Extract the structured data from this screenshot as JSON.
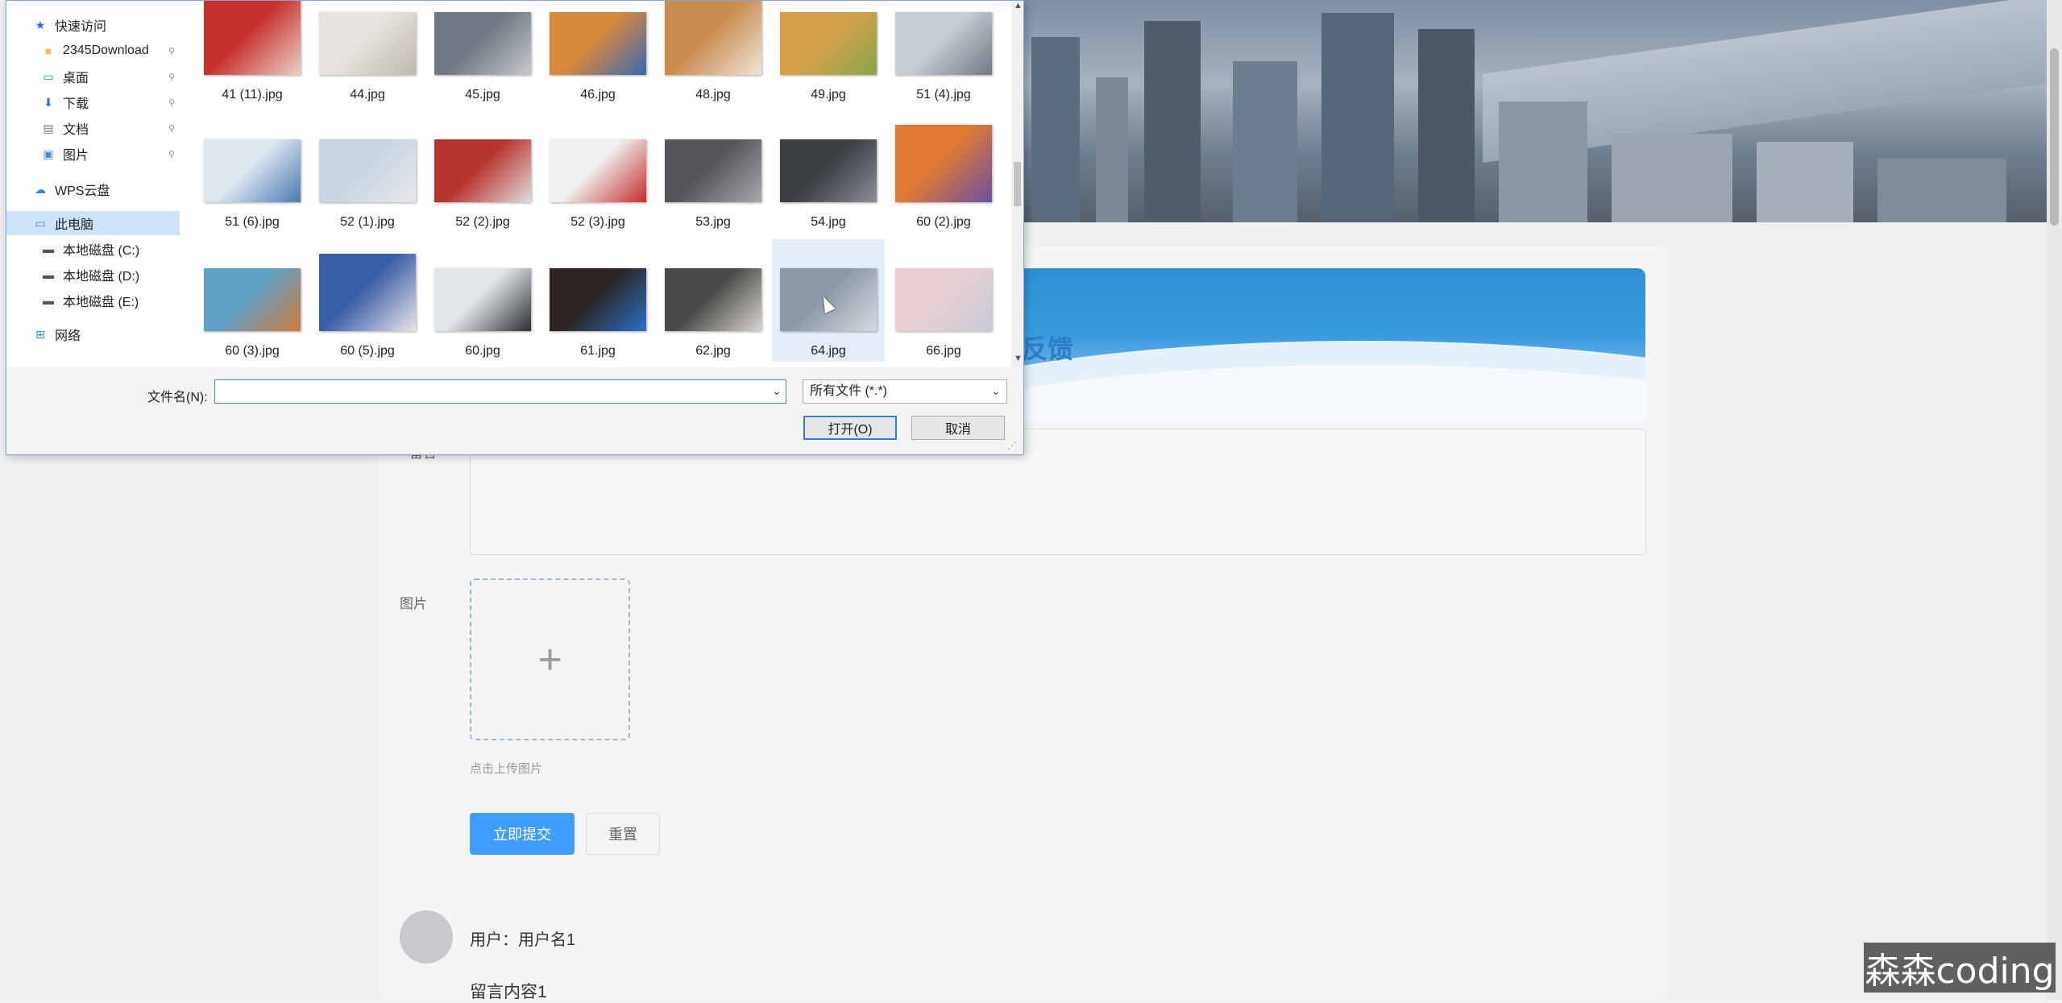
{
  "dialog": {
    "nav": [
      {
        "label": "快速访问",
        "icon": "star-pin-icon",
        "pinned": false
      },
      {
        "label": "2345Download",
        "icon": "folder-icon",
        "pinned": true
      },
      {
        "label": "桌面",
        "icon": "desktop-icon",
        "pinned": true
      },
      {
        "label": "下载",
        "icon": "download-arrow-icon",
        "pinned": true
      },
      {
        "label": "文档",
        "icon": "document-icon",
        "pinned": true
      },
      {
        "label": "图片",
        "icon": "pictures-icon",
        "pinned": true
      },
      {
        "label": "WPS云盘",
        "icon": "cloud-icon",
        "pinned": false
      },
      {
        "label": "此电脑",
        "icon": "computer-icon",
        "pinned": false
      },
      {
        "label": "本地磁盘 (C:)",
        "icon": "drive-icon",
        "pinned": false
      },
      {
        "label": "本地磁盘 (D:)",
        "icon": "drive-icon",
        "pinned": false
      },
      {
        "label": "本地磁盘 (E:)",
        "icon": "drive-icon",
        "pinned": false
      },
      {
        "label": "网络",
        "icon": "network-icon",
        "pinned": false
      }
    ],
    "files": [
      "41 (11).jpg",
      "44.jpg",
      "45.jpg",
      "46.jpg",
      "48.jpg",
      "49.jpg",
      "51 (4).jpg",
      "51 (6).jpg",
      "52 (1).jpg",
      "52 (2).jpg",
      "52 (3).jpg",
      "53.jpg",
      "54.jpg",
      "60 (2).jpg",
      "60 (3).jpg",
      "60 (5).jpg",
      "60.jpg",
      "61.jpg",
      "62.jpg",
      "64.jpg",
      "66.jpg"
    ],
    "thumb_colors": [
      [
        "#c8302e",
        "#e9d2c8"
      ],
      [
        "#e6e3de",
        "#bdb7ae"
      ],
      [
        "#6f7883",
        "#c7c9cc"
      ],
      [
        "#d88a3a",
        "#3868b4"
      ],
      [
        "#c98b4e",
        "#efe4d6"
      ],
      [
        "#d5a24b",
        "#88a54a"
      ],
      [
        "#c8ced6",
        "#707884"
      ],
      [
        "#dfe7f1",
        "#4c78b0"
      ],
      [
        "#c8d5e2",
        "#e7e9ea"
      ],
      [
        "#b8342f",
        "#dedede"
      ],
      [
        "#f0f0f0",
        "#c22b2b"
      ],
      [
        "#55565a",
        "#a7a9ad"
      ],
      [
        "#3a3d42",
        "#8a8f96"
      ],
      [
        "#e07a34",
        "#6b4fa0"
      ],
      [
        "#5e9fc4",
        "#d17d3c"
      ],
      [
        "#3a5ea8",
        "#e8e4e6"
      ],
      [
        "#e4e7ea",
        "#2a2d33"
      ],
      [
        "#2b2420",
        "#2c6fc7"
      ],
      [
        "#4c4a48",
        "#d8d5cf"
      ],
      [
        "#8c9aa8",
        "#d6dadf"
      ],
      [
        "#e8cfd4",
        "#c7cbd5"
      ]
    ],
    "selected_file": "64.jpg",
    "filename_label": "文件名(N):",
    "filename_value": "",
    "filetype_value": "所有文件 (*.*)",
    "open_label": "打开(O)",
    "cancel_label": "取消"
  },
  "page": {
    "feedback_title": "反馈",
    "content_label": "留言",
    "image_label": "图片",
    "upload_hint": "点击上传图片",
    "submit_label": "立即提交",
    "reset_label": "重置",
    "comment_user": "用户：用户名1",
    "comment_content": "留言内容1",
    "watermark": "森森coding"
  }
}
